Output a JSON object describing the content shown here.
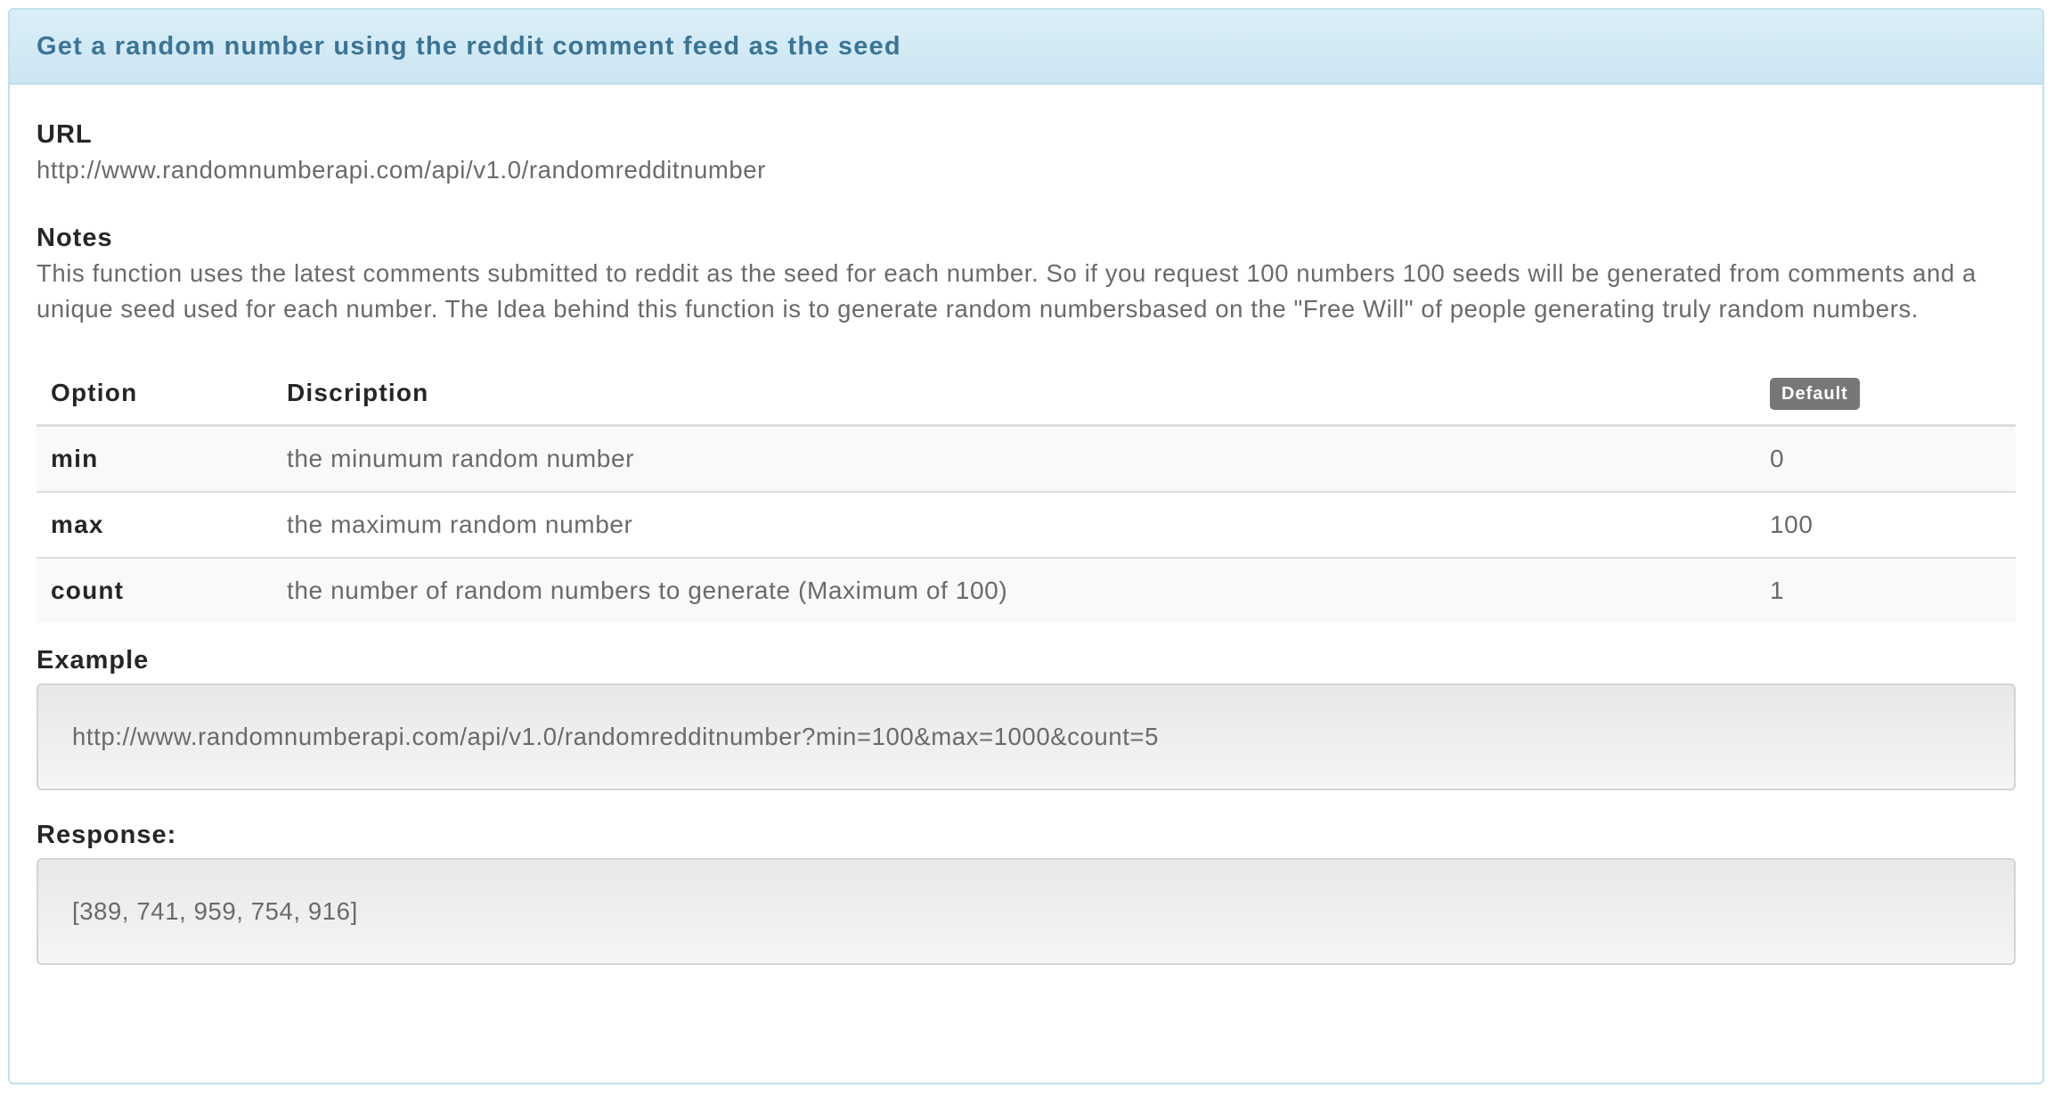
{
  "panel": {
    "title": "Get a random number using the reddit comment feed as the seed"
  },
  "url_section": {
    "label": "URL",
    "value": "http://www.randomnumberapi.com/api/v1.0/randomredditnumber"
  },
  "notes_section": {
    "label": "Notes",
    "text": "This function uses the latest comments submitted to reddit as the seed for each number. So if you request 100 numbers 100 seeds will be generated from comments and a unique seed used for each number. The Idea behind this function is to generate random numbersbased on the \"Free Will\" of people generating truly random numbers."
  },
  "options_table": {
    "headers": {
      "option": "Option",
      "description": "Discription",
      "default": "Default"
    },
    "rows": [
      {
        "option": "min",
        "description": "the minumum random number",
        "default": "0"
      },
      {
        "option": "max",
        "description": "the maximum random number",
        "default": "100"
      },
      {
        "option": "count",
        "description": "the number of random numbers to generate (Maximum of 100)",
        "default": "1"
      }
    ]
  },
  "example_section": {
    "label": "Example",
    "value": "http://www.randomnumberapi.com/api/v1.0/randomredditnumber?min=100&max=1000&count=5"
  },
  "response_section": {
    "label": "Response:",
    "value": "[389, 741, 959, 754, 916]"
  },
  "colors": {
    "heading_bg": "#d9edf7",
    "heading_text": "#3a7497",
    "panel_border": "#bce8f1",
    "badge_bg": "#777777"
  }
}
